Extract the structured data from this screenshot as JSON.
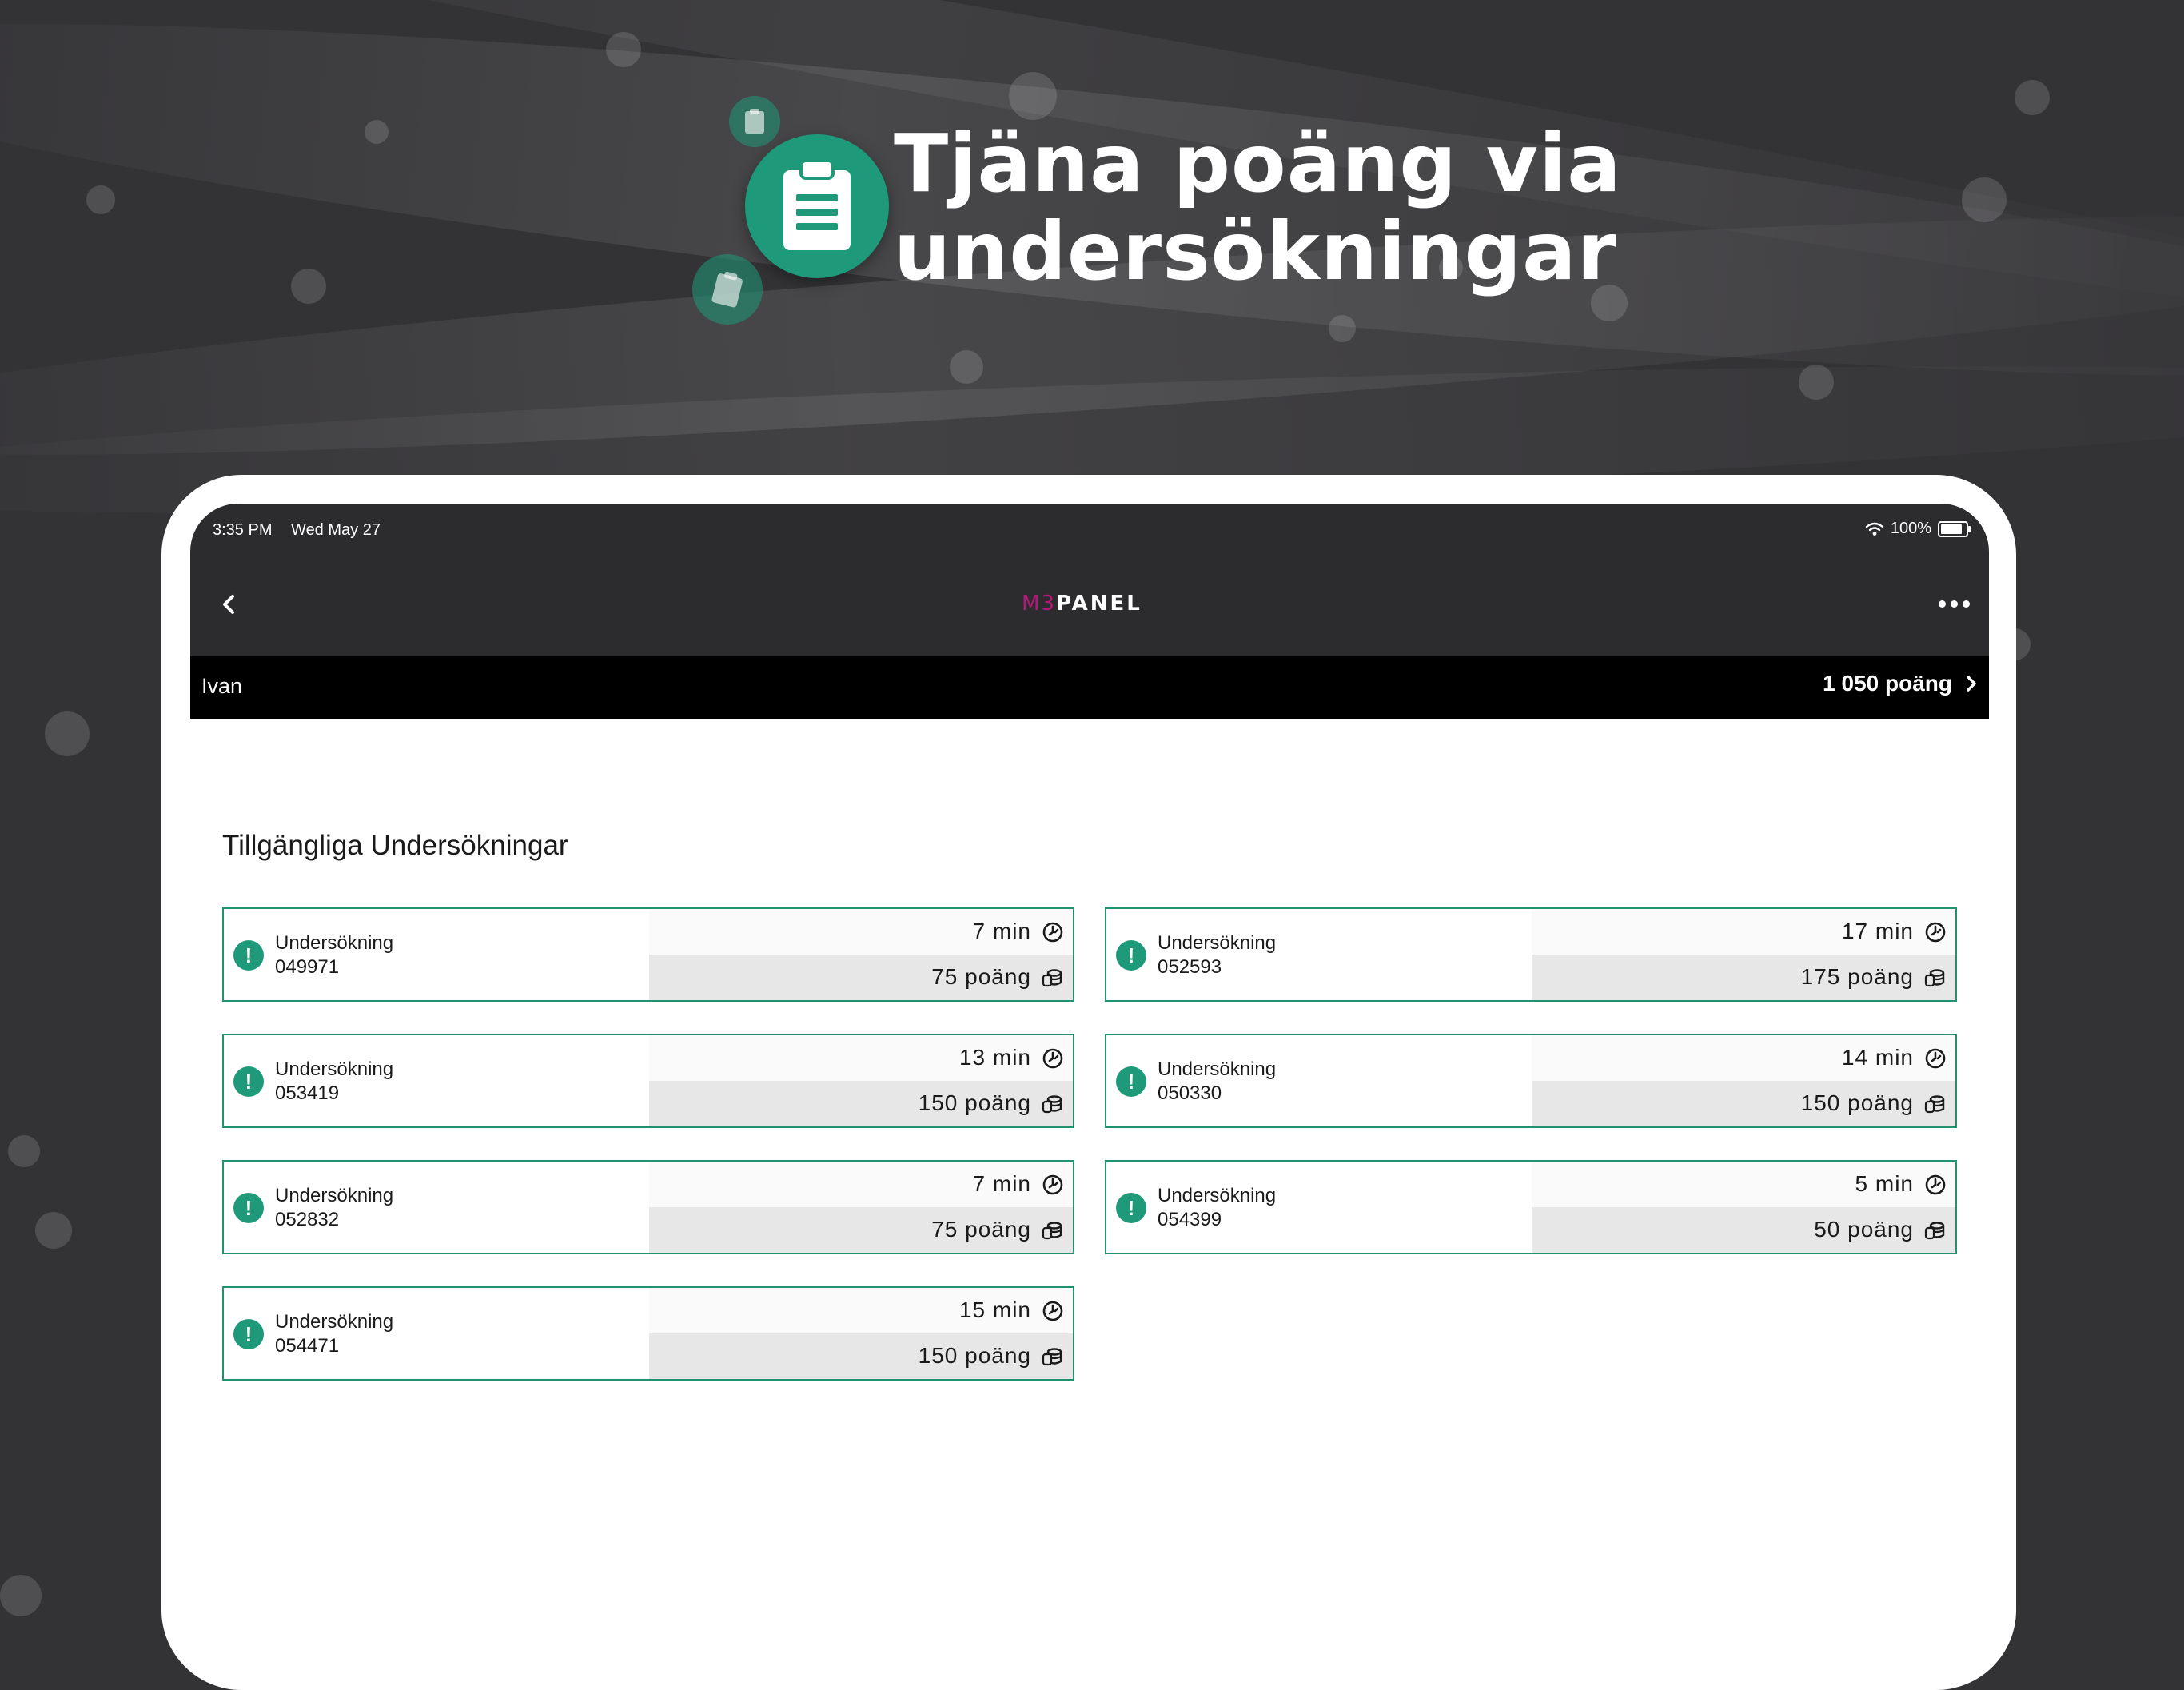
{
  "hero": {
    "title_line1": "Tjäna poäng via",
    "title_line2": "undersökningar"
  },
  "colors": {
    "brand_green": "#1e9a7a",
    "card_border": "#20926f",
    "logo_magenta": "#b2187a",
    "background": "#333235",
    "app_bar": "#2c2b2e"
  },
  "status_bar": {
    "time": "3:35 PM",
    "date": "Wed May 27",
    "battery": "100%",
    "battery_level": 1.0
  },
  "nav": {
    "back_icon": "chevron-left-icon",
    "logo_m3": "M3",
    "logo_panel": "PANEL",
    "more_icon": "more-dots-icon"
  },
  "user_bar": {
    "name": "Ivan",
    "points": "1 050 poäng"
  },
  "section_title": "Tillgängliga Undersökningar",
  "surveys": [
    {
      "label": "Undersökning",
      "id": "049971",
      "time": "7 min",
      "points": "75 poäng"
    },
    {
      "label": "Undersökning",
      "id": "052593",
      "time": "17 min",
      "points": "175 poäng"
    },
    {
      "label": "Undersökning",
      "id": "053419",
      "time": "13 min",
      "points": "150 poäng"
    },
    {
      "label": "Undersökning",
      "id": "050330",
      "time": "14 min",
      "points": "150 poäng"
    },
    {
      "label": "Undersökning",
      "id": "052832",
      "time": "7 min",
      "points": "75 poäng"
    },
    {
      "label": "Undersökning",
      "id": "054399",
      "time": "5 min",
      "points": "50 poäng"
    },
    {
      "label": "Undersökning",
      "id": "054471",
      "time": "15 min",
      "points": "150 poäng"
    }
  ]
}
